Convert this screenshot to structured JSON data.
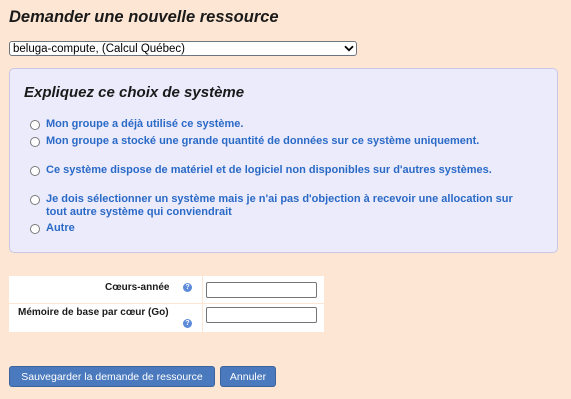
{
  "page": {
    "title": "Demander une nouvelle ressource"
  },
  "system_select": {
    "value": "beluga-compute, (Calcul Québec)"
  },
  "reason_panel": {
    "title": "Expliquez ce choix de système",
    "options": [
      {
        "label": "Mon groupe a déjà utilisé ce système."
      },
      {
        "label": "Mon groupe a stocké une grande quantité de données sur ce système uniquement."
      },
      {
        "label": "Ce système dispose de matériel et de logiciel non disponibles sur d'autres systèmes."
      },
      {
        "label": "Je dois sélectionner un système mais je n'ai pas d'objection à recevoir une allocation sur tout autre système qui conviendrait"
      },
      {
        "label": "Autre"
      }
    ]
  },
  "form": {
    "core_years_label": "Cœurs-année",
    "memory_label": "Mémoire de base par cœur (Go)",
    "help_glyph": "?"
  },
  "buttons": {
    "save_label": "Sauvegarder la demande de ressource",
    "cancel_label": "Annuler"
  },
  "colors": {
    "background": "#fde6d3",
    "panel": "#ecebfb",
    "link_blue": "#2a6ac7",
    "button_blue": "#4a79bd"
  }
}
